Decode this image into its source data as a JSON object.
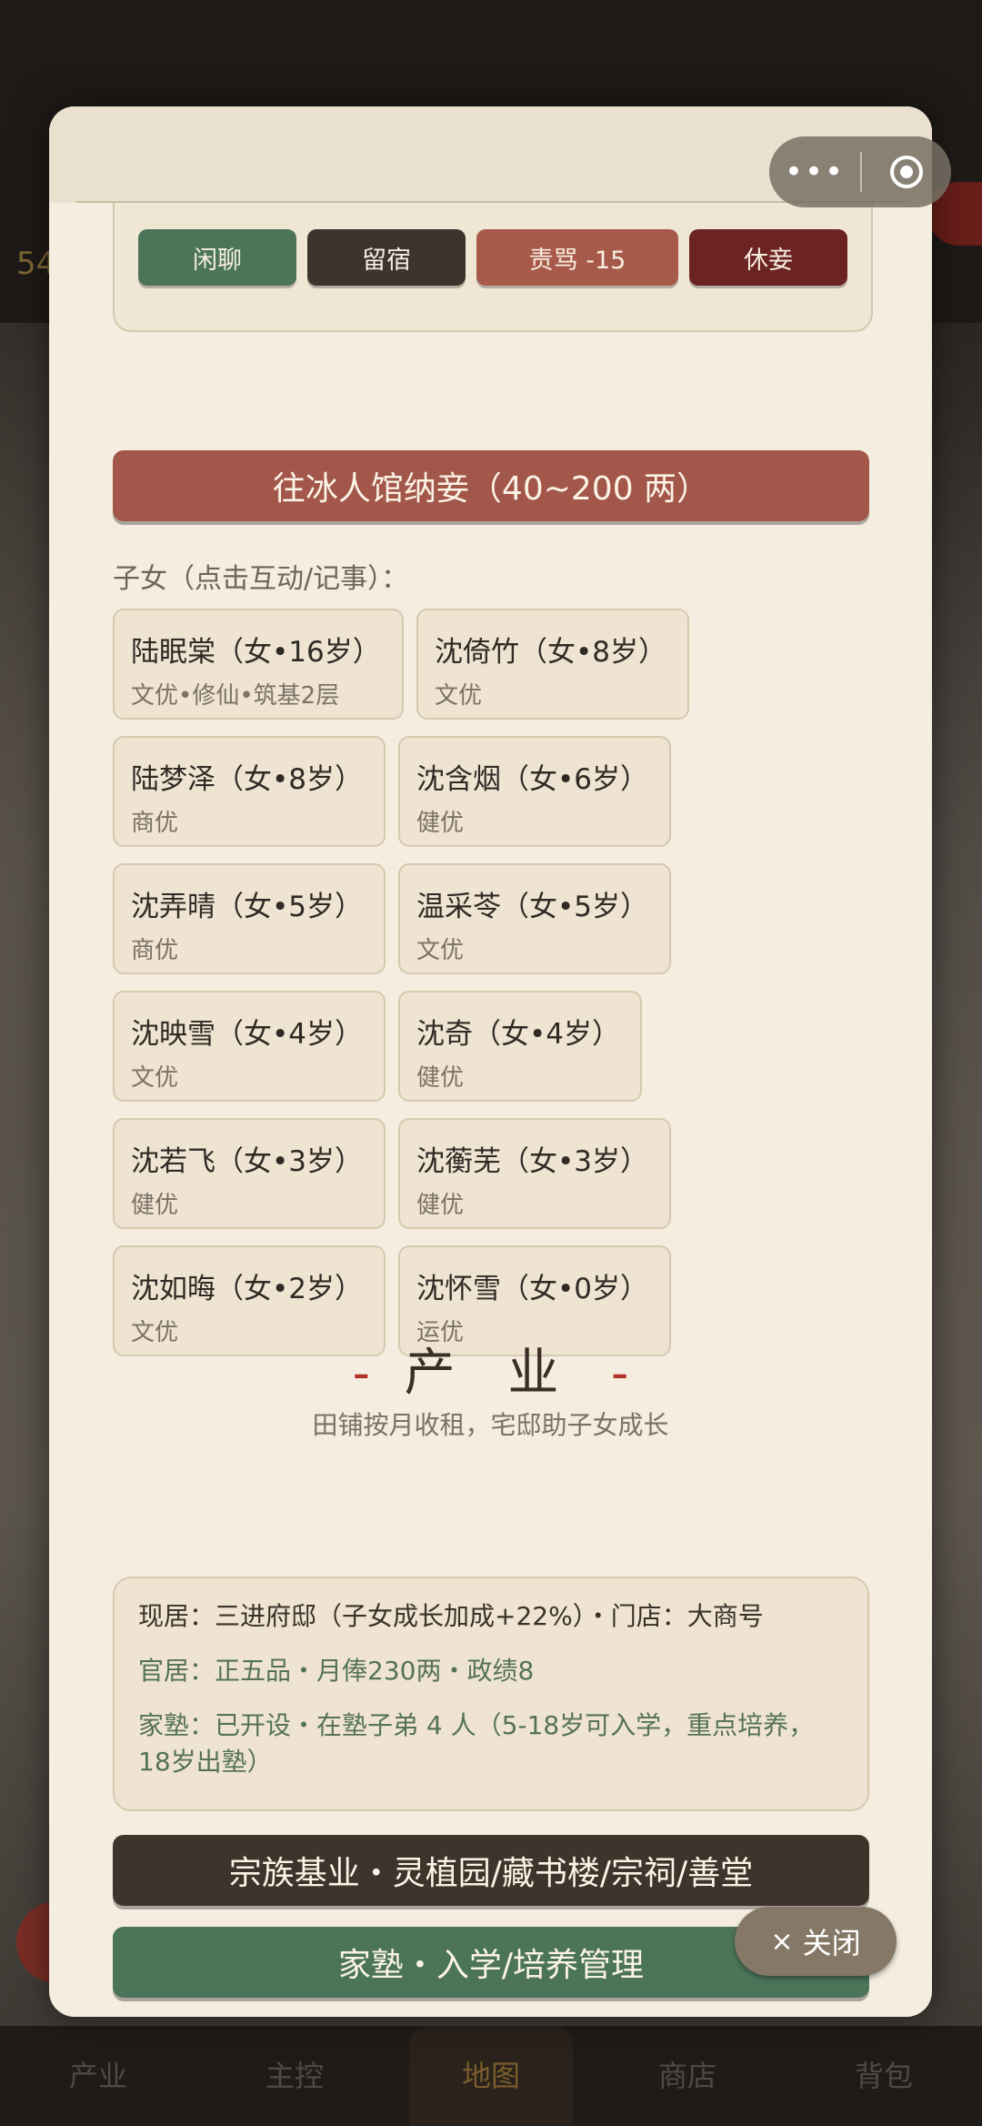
{
  "bottom_nav": [
    "产业",
    "主控",
    "地图",
    "商店",
    "背包"
  ],
  "background": {
    "coin_text": "54"
  },
  "capsule": {
    "more": "•••",
    "target_icon": "target-icon"
  },
  "actions": [
    {
      "label": "闲聊",
      "color": "#4b7459"
    },
    {
      "label": "留宿",
      "color": "#3d342d"
    },
    {
      "label": "责骂 -15",
      "color": "#a85a4a"
    },
    {
      "label": "休妾",
      "color": "#6b2421"
    }
  ],
  "concubine_button": "往冰人馆纳妾（40~200 两）",
  "children_hint": "子女（点击互动/记事）：",
  "children": [
    {
      "name": "陆眠棠（女•16岁）",
      "traits": "文优•修仙•筑基2层"
    },
    {
      "name": "沈倚竹（女•8岁）",
      "traits": "文优"
    },
    {
      "name": "陆梦泽（女•8岁）",
      "traits": "商优"
    },
    {
      "name": "沈含烟（女•6岁）",
      "traits": "健优"
    },
    {
      "name": "沈弄晴（女•5岁）",
      "traits": "商优"
    },
    {
      "name": "温采苓（女•5岁）",
      "traits": "文优"
    },
    {
      "name": "沈映雪（女•4岁）",
      "traits": "文优"
    },
    {
      "name": "沈奇（女•4岁）",
      "traits": "健优"
    },
    {
      "name": "沈若飞（女•3岁）",
      "traits": "健优"
    },
    {
      "name": "沈蘅芜（女•3岁）",
      "traits": "健优"
    },
    {
      "name": "沈如晦（女•2岁）",
      "traits": "文优"
    },
    {
      "name": "沈怀雪（女•0岁）",
      "traits": "运优"
    }
  ],
  "industry": {
    "title": "产 业",
    "dash": "-",
    "subtitle": "田铺按月收租，宅邸助子女成长",
    "residence": "现居：三进府邸（子女成长加成+22%）・门店：大商号",
    "office": "官居：正五品・月俸230两・政绩8",
    "school": "家塾：已开设・在塾子弟 4 人（5-18岁可入学，重点培养，18岁出塾）"
  },
  "clan_button": "宗族基业・灵植园/藏书楼/宗祠/善堂",
  "school_button": "家塾・入学/培养管理",
  "close_button": {
    "icon": "×",
    "label": "关闭"
  }
}
